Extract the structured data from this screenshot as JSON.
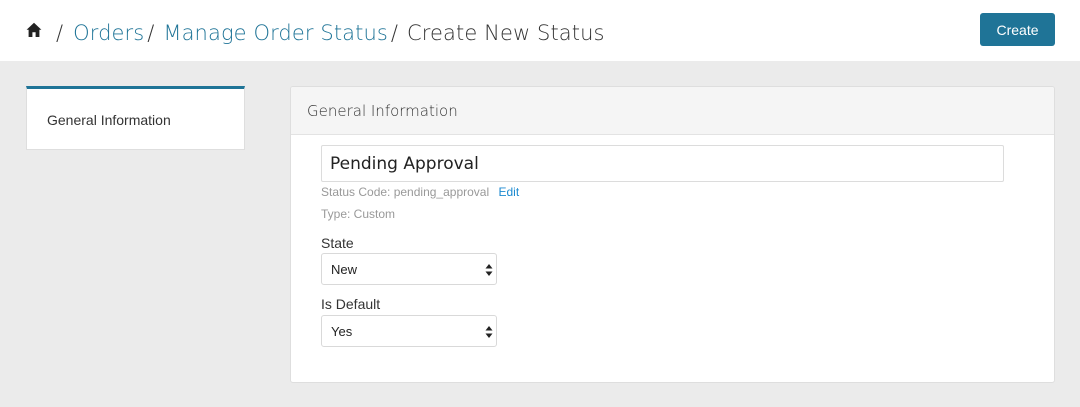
{
  "breadcrumb": {
    "home_icon": "home-icon",
    "separator": "/",
    "items": [
      "Orders",
      "Manage Order Status"
    ],
    "current": "Create New Status"
  },
  "header": {
    "create_label": "Create"
  },
  "sidebar": {
    "items": [
      {
        "label": "General Information"
      }
    ]
  },
  "panel": {
    "title": "General Information",
    "name_value": "Pending Approval",
    "status_code_text": "Status Code: pending_approval",
    "edit_label": "Edit",
    "type_text": "Type: Custom",
    "state": {
      "label": "State",
      "selected": "New"
    },
    "is_default": {
      "label": "Is Default",
      "selected": "Yes"
    }
  },
  "colors": {
    "accent": "#1f7497",
    "link": "#1c8ad0",
    "page_bg": "#ebebeb"
  }
}
